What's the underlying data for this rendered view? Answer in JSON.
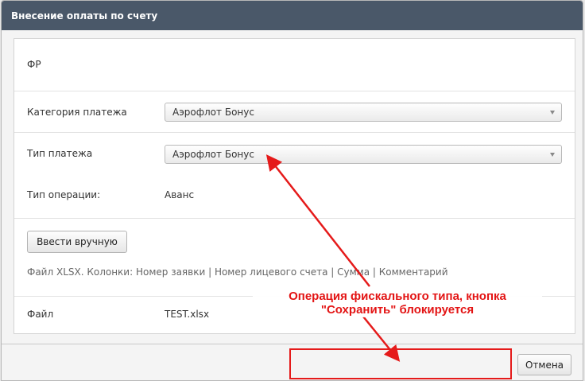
{
  "dialog": {
    "title": "Внесение оплаты по счету",
    "fr_label": "ФР",
    "payment_category_label": "Категория платежа",
    "payment_category_value": "Аэрофлот Бонус",
    "payment_type_label": "Тип платежа",
    "payment_type_value": "Аэрофлот Бонус",
    "operation_type_label": "Тип операции:",
    "operation_type_value": "Аванс",
    "manual_button": "Ввести вручную",
    "file_hint": "Файл XLSX. Колонки: Номер заявки | Номер лицевого счета | Сумма | Комментарий",
    "file_label": "Файл",
    "file_value": "TEST.xlsx",
    "cancel_button": "Отмена"
  },
  "annotation": {
    "line1": "Операция фискального типа, кнопка",
    "line2": "\"Сохранить\" блокируется",
    "color": "#e31414"
  }
}
